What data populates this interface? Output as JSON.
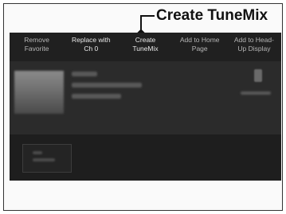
{
  "callout": {
    "label": "Create TuneMix"
  },
  "menu_bar": {
    "items": [
      {
        "label": "Remove\nFavorite",
        "dim": true
      },
      {
        "label": "Replace with\nCh 0",
        "dim": false
      },
      {
        "label": "Create\nTuneMix",
        "dim": false
      },
      {
        "label": "Add to Home\nPage",
        "dim": true
      },
      {
        "label": "Add to Head-\nUp Display",
        "dim": true
      }
    ]
  }
}
